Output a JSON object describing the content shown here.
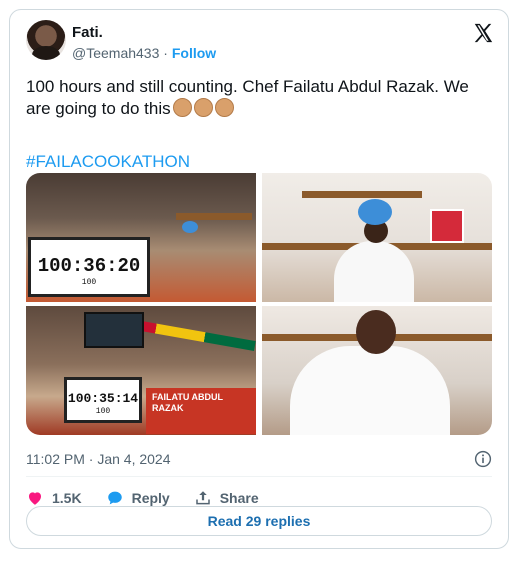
{
  "user": {
    "name": "Fati.",
    "handle": "@Teemah433",
    "separator": "·",
    "follow_label": "Follow"
  },
  "tweet": {
    "text": "100 hours and still counting. Chef Failatu Abdul Razak. We are going to do this",
    "emojis": [
      "clapping-hands-icon",
      "clapping-hands-icon",
      "clapping-hands-icon"
    ],
    "hashtag": "#FAILACOOKATHON"
  },
  "media": {
    "timer_1": "100:36:20",
    "timer_1_sub": "100",
    "timer_2": "100:35:14",
    "timer_2_sub": "100",
    "banner_text": "FAILATU ABDUL RAZAK"
  },
  "meta": {
    "timestamp": "11:02 PM · Jan 4, 2024"
  },
  "actions": {
    "likes": "1.5K",
    "reply_label": "Reply",
    "share_label": "Share"
  },
  "read_replies_label": "Read 29 replies",
  "colors": {
    "accent": "#1d9bf0",
    "like": "#f91880",
    "border": "#cfd9de"
  }
}
